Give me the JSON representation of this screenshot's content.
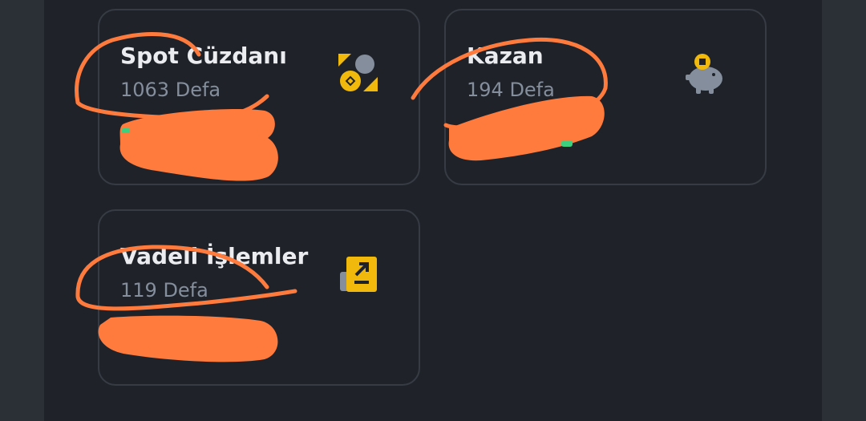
{
  "cards": [
    {
      "title": "Spot Cüzdanı",
      "count": "1063 Defa",
      "icon": "spot-wallet-icon"
    },
    {
      "title": "Kazan",
      "count": "194 Defa",
      "icon": "piggy-bank-icon"
    },
    {
      "title": "Vadeli İşlemler",
      "count": "119 Defa",
      "icon": "futures-icon"
    }
  ],
  "colors": {
    "background": "#1f2329",
    "card_border": "#363b44",
    "title": "#eaecef",
    "count": "#848e9c",
    "brand_yellow": "#f0b90b",
    "icon_gray": "#848e9c",
    "redaction": "#ff7a3d"
  }
}
